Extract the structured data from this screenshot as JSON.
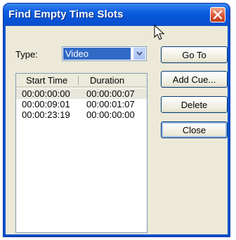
{
  "window": {
    "title": "Find Empty Time Slots"
  },
  "type_field": {
    "label": "Type:",
    "selected": "Video"
  },
  "list": {
    "columns": [
      "Start Time",
      "Duration"
    ],
    "rows": [
      {
        "start": "00:00:00:00",
        "duration": "00:00:00:07"
      },
      {
        "start": "00:00:09:01",
        "duration": "00:00:01:07"
      },
      {
        "start": "00:00:23:19",
        "duration": "00:00:00:00"
      }
    ]
  },
  "buttons": {
    "goto": "Go To",
    "add_cue": "Add Cue...",
    "delete": "Delete",
    "close": "Close"
  },
  "colors": {
    "titlebar": "#0753d6",
    "close_button": "#d9512f",
    "selection": "#316ac5",
    "dialog_face": "#ece9d8"
  }
}
